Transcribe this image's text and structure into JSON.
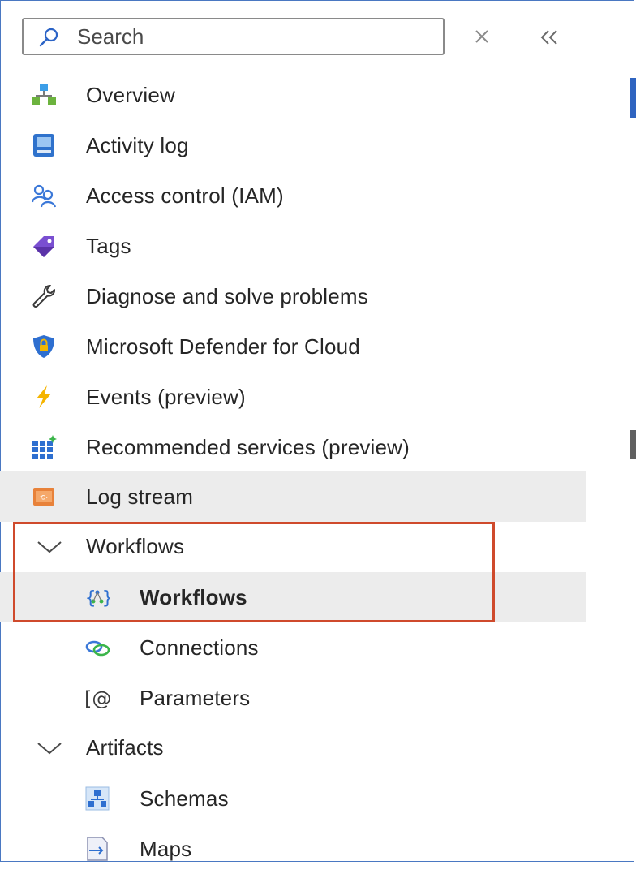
{
  "search": {
    "placeholder": "Search"
  },
  "menu": {
    "overview": "Overview",
    "activity_log": "Activity log",
    "access_control": "Access control (IAM)",
    "tags": "Tags",
    "diagnose": "Diagnose and solve problems",
    "defender": "Microsoft Defender for Cloud",
    "events": "Events (preview)",
    "recommended": "Recommended services (preview)",
    "log_stream": "Log stream"
  },
  "groups": {
    "workflows": {
      "label": "Workflows",
      "items": {
        "workflows": "Workflows",
        "connections": "Connections",
        "parameters": "Parameters"
      }
    },
    "artifacts": {
      "label": "Artifacts",
      "items": {
        "schemas": "Schemas",
        "maps": "Maps"
      }
    }
  },
  "colors": {
    "highlight": "#cf4a2c",
    "selected_bg": "#ececec",
    "accent": "#2f64c0"
  }
}
